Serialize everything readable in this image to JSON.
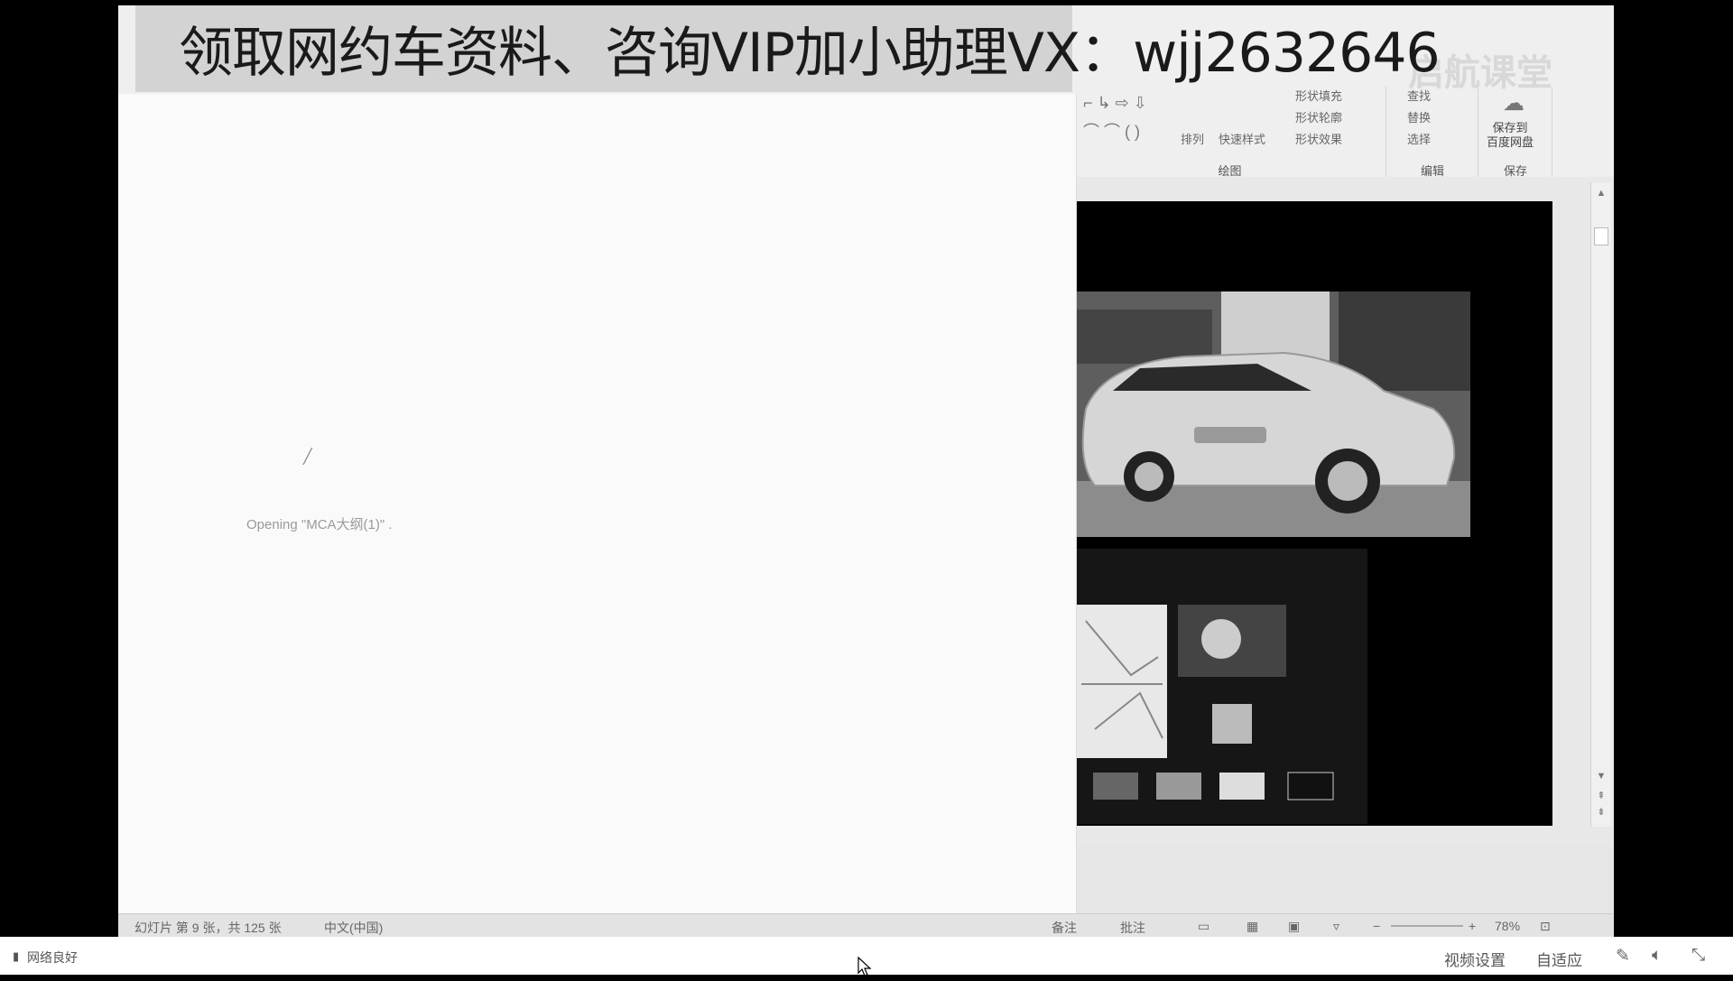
{
  "banner": {
    "text": "领取网约车资料、咨询VIP加小助理VX：wjj2632646"
  },
  "brand_watermark": "启航课堂",
  "ribbon": {
    "drawing_group": {
      "label": "绘图",
      "arrange_label": "排列",
      "quick_styles_label": "快速样式",
      "shape_fill_label": "形状填充",
      "shape_outline_label": "形状轮廓",
      "shape_effects_label": "形状效果"
    },
    "editing_group": {
      "label": "编辑",
      "find_label": "查找",
      "replace_label": "替换",
      "select_label": "选择"
    },
    "save_group": {
      "label": "保存",
      "save_to_cloud_label": "保存到\n百度网盘"
    }
  },
  "dialog": {
    "opening_text": "Opening \"MCA大纲(1)\" ."
  },
  "statusbar": {
    "slide_info": "幻灯片 第 9 张，共 125 张",
    "language": "中文(中国)",
    "notes_label": "备注",
    "comments_label": "批注",
    "zoom": "78%"
  },
  "player": {
    "network_status": "网络良好",
    "video_settings": "视频设置",
    "auto_fit": "自适应"
  },
  "icons": {
    "signal": "signal-bars-icon",
    "spinner": "loading-spinner-icon",
    "volume": "volume-icon",
    "fullscreen_exit": "exit-fullscreen-icon",
    "cloud": "baidu-cloud-icon"
  },
  "colors": {
    "banner_bg": "#d2d2d2",
    "banner_text": "#1a1a1a",
    "slide_bg": "#000000"
  }
}
